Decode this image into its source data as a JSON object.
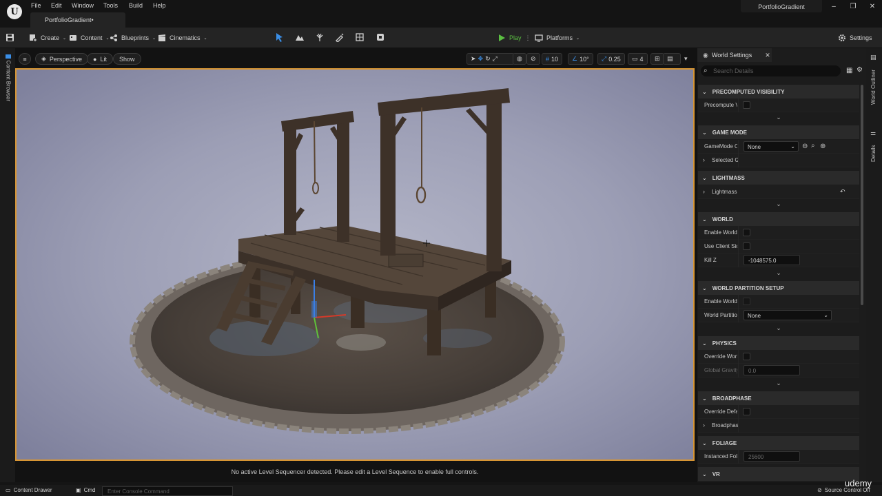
{
  "menu": {
    "items": [
      "File",
      "Edit",
      "Window",
      "Tools",
      "Build",
      "Help"
    ]
  },
  "tab": {
    "title": "PortfolioGradient•"
  },
  "window": {
    "project": "PortfolioGradient",
    "minimize": "–",
    "restore": "❐",
    "close": "✕"
  },
  "toolbar": {
    "create": "Create",
    "content": "Content",
    "blueprints": "Blueprints",
    "cinematics": "Cinematics",
    "play": "Play",
    "platforms": "Platforms",
    "settings": "Settings"
  },
  "left_panel": {
    "content_browser": "Content Browser"
  },
  "viewport": {
    "perspective": "Perspective",
    "lit": "Lit",
    "show": "Show",
    "grid_snap": "10",
    "rotation_snap": "10°",
    "scale_snap": "0.25",
    "camera_speed": "4",
    "message": "No active Level Sequencer detected. Please edit a Level Sequence to enable full controls."
  },
  "panel": {
    "tab": "World Settings",
    "search_placeholder": "Search Details",
    "sections": {
      "precomputed": {
        "title": "PRECOMPUTED VISIBILITY",
        "precompute": "Precompute V"
      },
      "gamemode": {
        "title": "GAME MODE",
        "override": "GameMode Ov",
        "override_value": "None",
        "selected": "Selected Ga"
      },
      "lightmass": {
        "title": "LIGHTMASS",
        "lightmass": "Lightmass"
      },
      "world": {
        "title": "WORLD",
        "enable_world": "Enable World C",
        "use_client": "Use Client Side",
        "kill_z": "Kill Z",
        "kill_z_value": "-1048575.0"
      },
      "partition": {
        "title": "WORLD PARTITION SETUP",
        "enable": "Enable World P",
        "world_partition": "World Partition",
        "world_partition_value": "None"
      },
      "physics": {
        "title": "PHYSICS",
        "override": "Override World",
        "gravity": "Global Gravity",
        "gravity_value": "0.0"
      },
      "broadphase": {
        "title": "BROADPHASE",
        "override": "Override Defau",
        "broadphase": "Broadphase"
      },
      "foliage": {
        "title": "FOLIAGE",
        "instanced": "Instanced Folia",
        "instanced_value": "25600"
      },
      "vr": {
        "title": "VR"
      }
    }
  },
  "right_strip": {
    "outliner": "World Outliner",
    "details": "Details"
  },
  "bottom": {
    "content_drawer": "Content Drawer",
    "cmd": "Cmd",
    "console_placeholder": "Enter Console Command",
    "source_control": "Source Control Off",
    "watermark": "udemy"
  },
  "colors": {
    "accent": "#d79533",
    "play": "#5bbf42",
    "background": "#151515",
    "panel": "#1c1c1c"
  }
}
